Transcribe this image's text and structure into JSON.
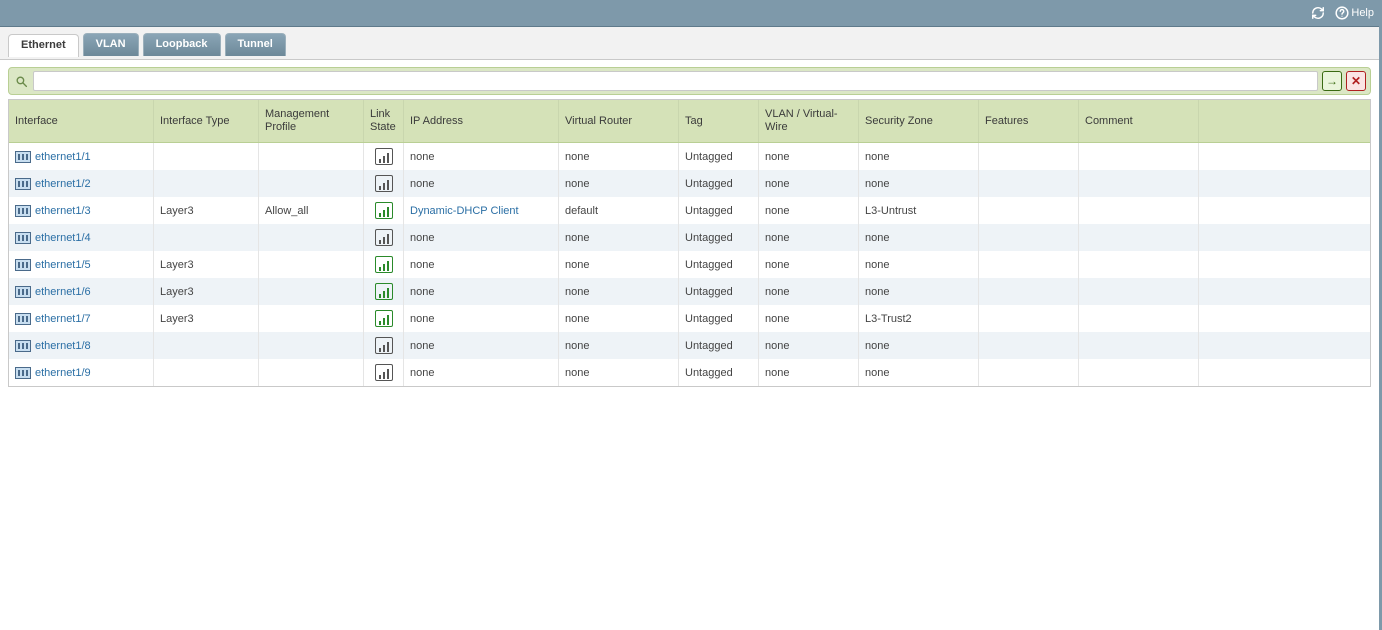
{
  "topbar": {
    "help_label": "Help"
  },
  "tabs": [
    {
      "label": "Ethernet",
      "active": true
    },
    {
      "label": "VLAN",
      "active": false
    },
    {
      "label": "Loopback",
      "active": false
    },
    {
      "label": "Tunnel",
      "active": false
    }
  ],
  "search": {
    "value": ""
  },
  "columns": [
    "Interface",
    "Interface Type",
    "Management Profile",
    "Link State",
    "IP Address",
    "Virtual Router",
    "Tag",
    "VLAN / Virtual-Wire",
    "Security Zone",
    "Features",
    "Comment",
    ""
  ],
  "rows": [
    {
      "interface": "ethernet1/1",
      "interface_type": "",
      "management_profile": "",
      "link_state": "grey",
      "ip_address": "none",
      "ip_link": false,
      "virtual_router": "none",
      "tag": "Untagged",
      "vlan_vwire": "none",
      "security_zone": "none",
      "features": "",
      "comment": ""
    },
    {
      "interface": "ethernet1/2",
      "interface_type": "",
      "management_profile": "",
      "link_state": "grey",
      "ip_address": "none",
      "ip_link": false,
      "virtual_router": "none",
      "tag": "Untagged",
      "vlan_vwire": "none",
      "security_zone": "none",
      "features": "",
      "comment": ""
    },
    {
      "interface": "ethernet1/3",
      "interface_type": "Layer3",
      "management_profile": "Allow_all",
      "link_state": "green",
      "ip_address": "Dynamic-DHCP Client",
      "ip_link": true,
      "virtual_router": "default",
      "tag": "Untagged",
      "vlan_vwire": "none",
      "security_zone": "L3-Untrust",
      "features": "",
      "comment": ""
    },
    {
      "interface": "ethernet1/4",
      "interface_type": "",
      "management_profile": "",
      "link_state": "grey",
      "ip_address": "none",
      "ip_link": false,
      "virtual_router": "none",
      "tag": "Untagged",
      "vlan_vwire": "none",
      "security_zone": "none",
      "features": "",
      "comment": ""
    },
    {
      "interface": "ethernet1/5",
      "interface_type": "Layer3",
      "management_profile": "",
      "link_state": "green",
      "ip_address": "none",
      "ip_link": false,
      "virtual_router": "none",
      "tag": "Untagged",
      "vlan_vwire": "none",
      "security_zone": "none",
      "features": "",
      "comment": ""
    },
    {
      "interface": "ethernet1/6",
      "interface_type": "Layer3",
      "management_profile": "",
      "link_state": "green",
      "ip_address": "none",
      "ip_link": false,
      "virtual_router": "none",
      "tag": "Untagged",
      "vlan_vwire": "none",
      "security_zone": "none",
      "features": "",
      "comment": ""
    },
    {
      "interface": "ethernet1/7",
      "interface_type": "Layer3",
      "management_profile": "",
      "link_state": "green",
      "ip_address": "none",
      "ip_link": false,
      "virtual_router": "none",
      "tag": "Untagged",
      "vlan_vwire": "none",
      "security_zone": "L3-Trust2",
      "features": "",
      "comment": ""
    },
    {
      "interface": "ethernet1/8",
      "interface_type": "",
      "management_profile": "",
      "link_state": "grey",
      "ip_address": "none",
      "ip_link": false,
      "virtual_router": "none",
      "tag": "Untagged",
      "vlan_vwire": "none",
      "security_zone": "none",
      "features": "",
      "comment": ""
    },
    {
      "interface": "ethernet1/9",
      "interface_type": "",
      "management_profile": "",
      "link_state": "grey",
      "ip_address": "none",
      "ip_link": false,
      "virtual_router": "none",
      "tag": "Untagged",
      "vlan_vwire": "none",
      "security_zone": "none",
      "features": "",
      "comment": ""
    }
  ]
}
